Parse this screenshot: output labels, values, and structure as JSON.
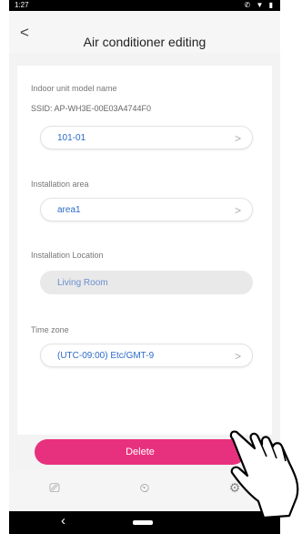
{
  "status": {
    "time": "1:27",
    "icons": "✆ ▼ ▮"
  },
  "header": {
    "title": "Air conditioner editing",
    "back_icon": "<"
  },
  "model": {
    "label": "Indoor unit model name",
    "ssid": "SSID: AP-WH3E-00E03A4744F0",
    "value": "101-01",
    "chevron": ">"
  },
  "installation_area": {
    "label": "Installation area",
    "value": "area1",
    "chevron": ">"
  },
  "installation_location": {
    "label": "Installation Location",
    "value": "Living Room"
  },
  "time_zone": {
    "label": "Time zone",
    "value": "(UTC-09:00) Etc/GMT-9",
    "chevron": ">"
  },
  "delete_label": "Delete",
  "tabs": [
    {
      "name": "devices-tab",
      "icon": "devices-icon",
      "glyph": "⎚"
    },
    {
      "name": "timer-tab",
      "icon": "timer-icon",
      "glyph": "⏲"
    },
    {
      "name": "settings-tab",
      "icon": "gear-icon",
      "glyph": "⚙"
    }
  ],
  "colors": {
    "accent": "#e8317e",
    "link": "#2d6bc7"
  }
}
